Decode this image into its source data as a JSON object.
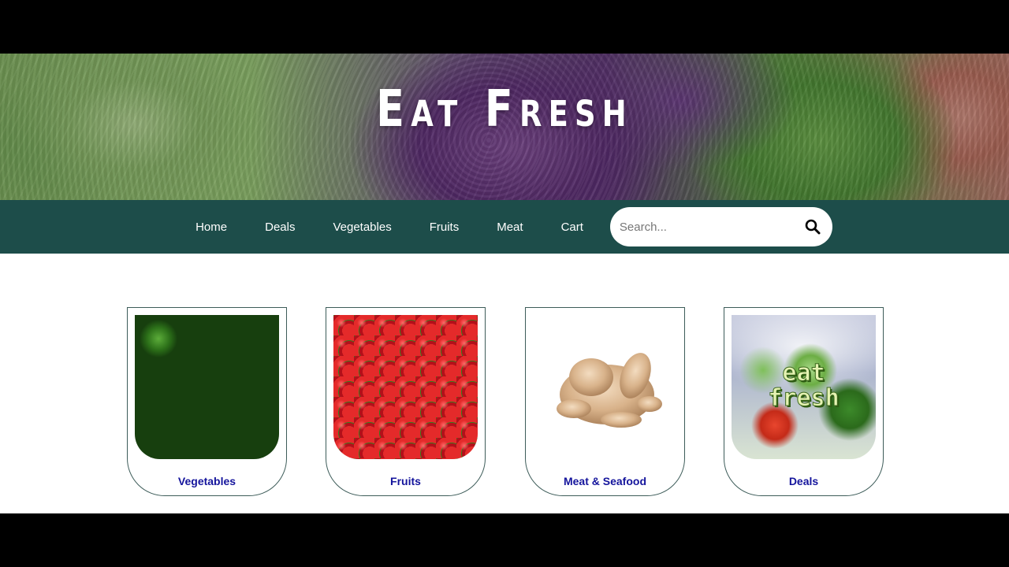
{
  "hero": {
    "title": "Eat Fresh"
  },
  "nav": {
    "links": [
      "Home",
      "Deals",
      "Vegetables",
      "Fruits",
      "Meat",
      "Cart"
    ]
  },
  "search": {
    "placeholder": "Search..."
  },
  "cards": [
    {
      "label": "Vegetables"
    },
    {
      "label": "Fruits"
    },
    {
      "label": "Meat & Seafood"
    },
    {
      "label": "Deals",
      "image_text": [
        "eat",
        "fresh"
      ]
    }
  ],
  "colors": {
    "nav_bg": "#1d4d4a",
    "card_label": "#14149c",
    "card_border": "#3d5c59"
  }
}
